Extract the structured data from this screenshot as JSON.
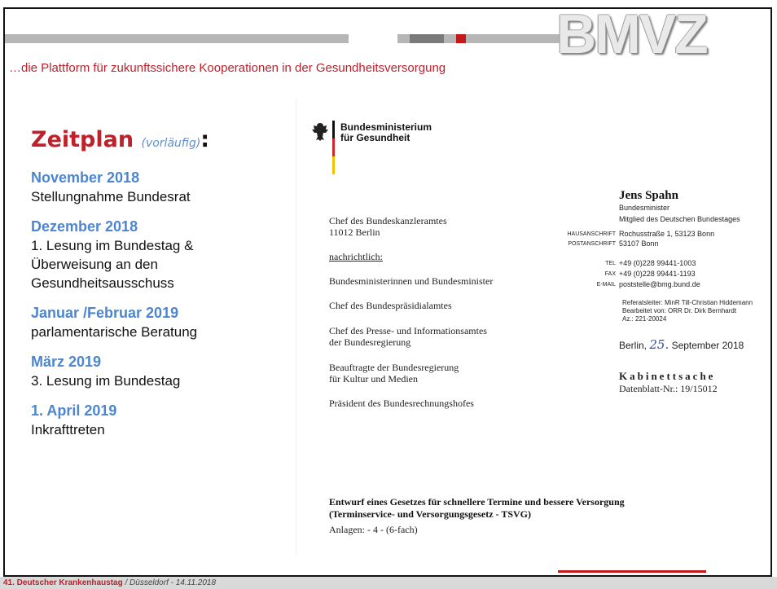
{
  "header": {
    "logo_text": "BMVZ",
    "tagline": "…die Plattform für zukunftssichere Kooperationen in der Gesundheitsversorgung"
  },
  "agenda": {
    "title": "Zeitplan",
    "title_note": "(vorläufig)",
    "title_colon": ":",
    "entries": [
      {
        "date": "November 2018",
        "text": "Stellungnahme Bundesrat"
      },
      {
        "date": "Dezember 2018",
        "text": "1. Lesung im Bundestag &\nÜberweisung an den\nGesundheitsausschuss"
      },
      {
        "date": "Januar /Februar 2019",
        "text": "parlamentarische Beratung"
      },
      {
        "date": "März 2019",
        "text": "3. Lesung im Bundestag"
      },
      {
        "date": "1. April 2019",
        "text": "Inkrafttreten"
      }
    ]
  },
  "letter": {
    "ministry": "Bundesministerium\nfür Gesundheit",
    "recipient": [
      "Chef des Bundeskanzleramtes",
      "11012 Berlin"
    ],
    "cc_label": "nachrichtlich:",
    "cc": [
      "Bundesministerinnen und Bundesminister",
      "Chef des Bundespräsidialamtes",
      "Chef des Presse- und Informationsamtes\nder Bundesregierung",
      "Beauftragte der Bundesregierung\nfür Kultur und Medien",
      "Präsident des Bundesrechnungshofes"
    ],
    "sender_name": "Jens Spahn",
    "sender_title": "Bundesminister",
    "sender_role": "Mitglied des Deutschen Bundestages",
    "address_label": "HAUSANSCHRIFT",
    "address": "Rochusstraße 1, 53123 Bonn",
    "postal_label": "POSTANSCHRIFT",
    "postal": "53107 Bonn",
    "tel_label": "TEL",
    "tel": "+49 (0)228 99441-1003",
    "fax_label": "FAX",
    "fax": "+49 (0)228 99441-1193",
    "email_label": "E-MAIL",
    "email": "poststelle@bmg.bund.de",
    "referat": "Referatsleiter:   MinR Till-Christian Hiddemann",
    "bearbeitet": "Bearbeitet von:  ORR Dr. Dirk Bernhardt",
    "az": "Az.: 221-20024",
    "date_prefix": "Berlin,",
    "date_day": "25.",
    "date_suffix": "September 2018",
    "kabinett": "Kabinettsache",
    "datenblatt": "Datenblatt-Nr.: 19/15012",
    "subject": "Entwurf eines Gesetzes für schnellere Termine und bessere Versorgung\n(Terminservice- und Versorgungsgesetz - TSVG)",
    "anlagen": "Anlagen:  - 4 - (6-fach)"
  },
  "footer": {
    "event": "41. Deutscher Krankenhaustag",
    "place": " / Düsseldorf  -  14.11.2018"
  }
}
